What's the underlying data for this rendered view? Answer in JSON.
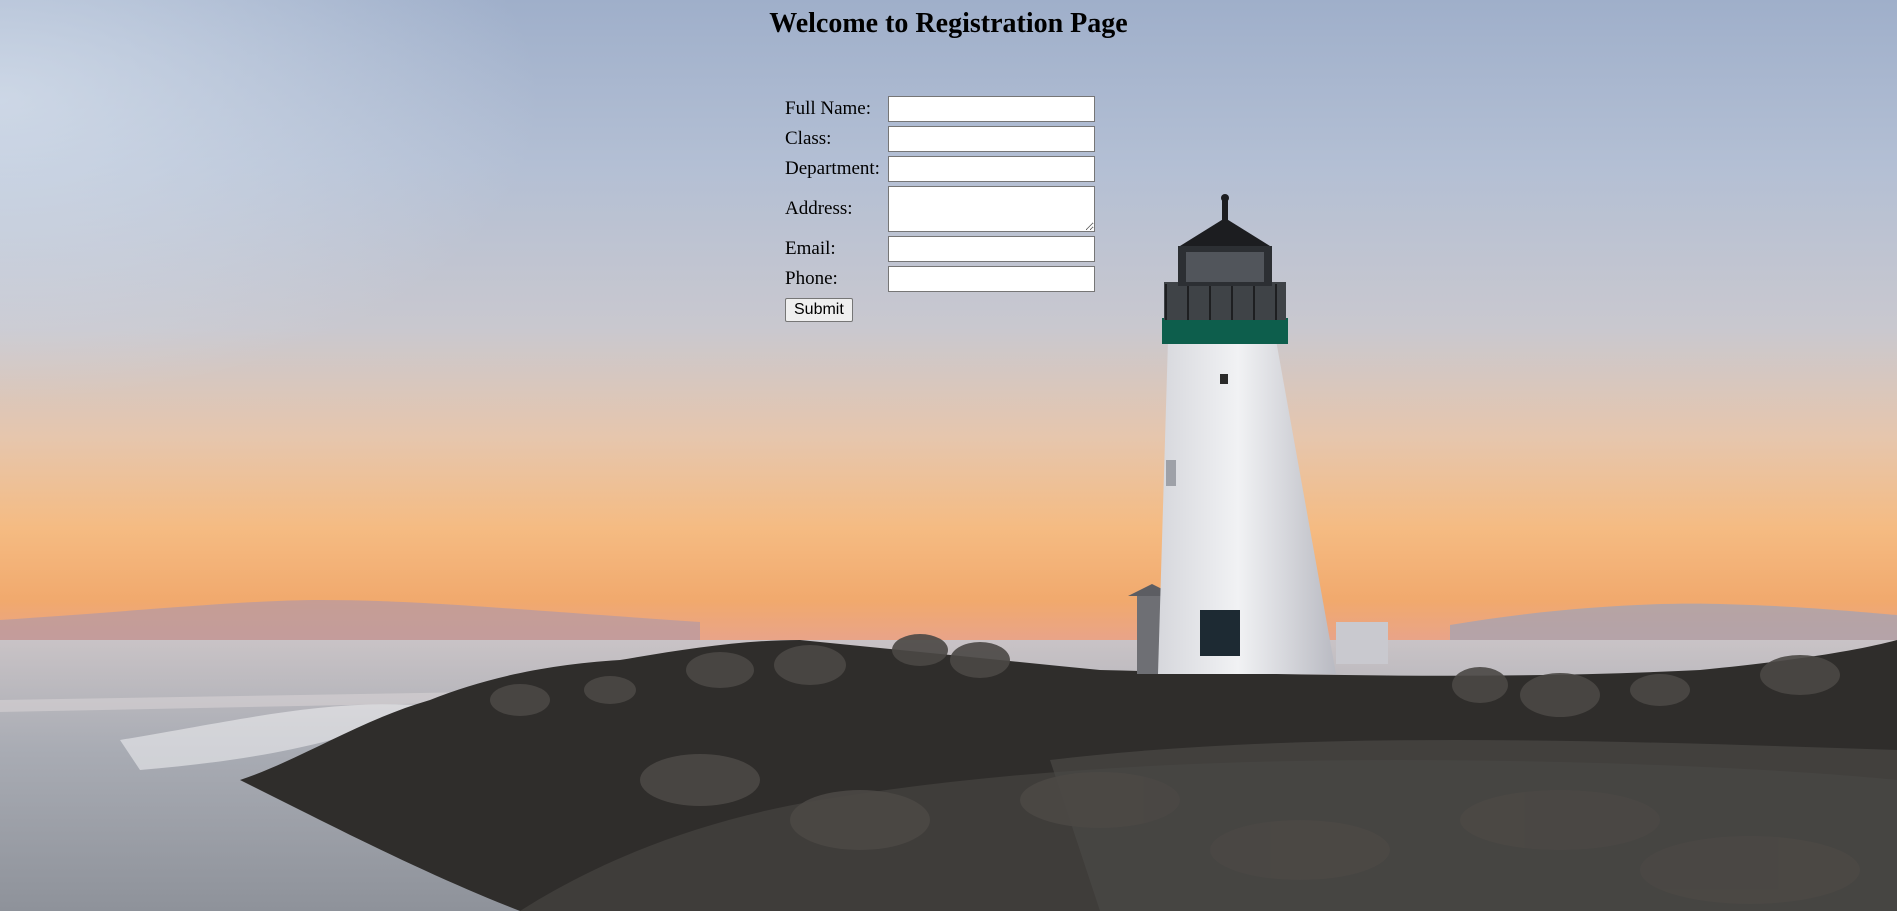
{
  "page": {
    "title": "Welcome to Registration Page",
    "background_image": "lighthouse-sunset"
  },
  "form": {
    "fields": [
      {
        "label": "Full Name:",
        "value": "",
        "type": "text"
      },
      {
        "label": "Class:",
        "value": "",
        "type": "text"
      },
      {
        "label": "Department:",
        "value": "",
        "type": "text"
      },
      {
        "label": "Address:",
        "value": "",
        "type": "textarea"
      },
      {
        "label": "Email:",
        "value": "",
        "type": "text"
      },
      {
        "label": "Phone:",
        "value": "",
        "type": "text"
      }
    ],
    "submit_label": "Submit"
  },
  "colors": {
    "sky_top": "#a9b8d0",
    "sky_mid": "#c2c7d3",
    "sunset": "#f2b57a",
    "horizon": "#f1a968",
    "sea": "#b9bcc2",
    "rocks": "#2b2a29",
    "lighthouse": "#e8e9ec",
    "lighthouse_band": "#0e5a4a"
  }
}
